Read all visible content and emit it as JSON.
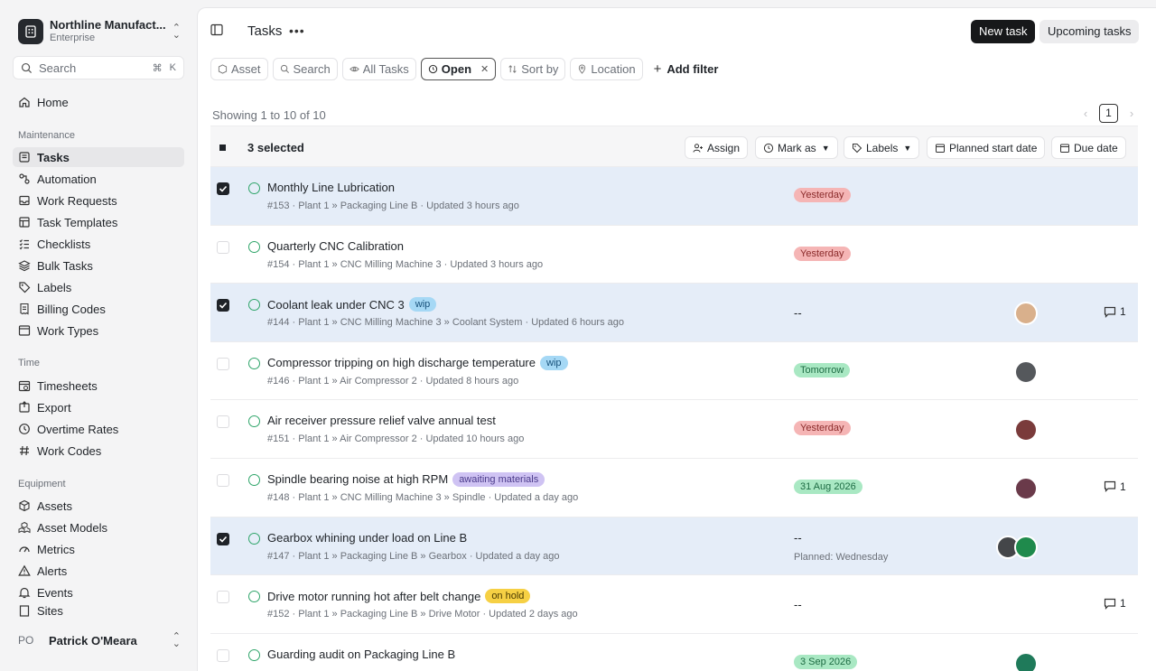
{
  "org": {
    "name": "Northline Manufact...",
    "plan": "Enterprise"
  },
  "search": {
    "label": "Search",
    "shortcut_mod": "⌘",
    "shortcut_key": "K"
  },
  "nav": {
    "home": "Home",
    "maintenance": {
      "heading": "Maintenance",
      "items": [
        "Tasks",
        "Automation",
        "Work Requests",
        "Task Templates",
        "Checklists",
        "Bulk Tasks",
        "Labels",
        "Billing Codes",
        "Work Types"
      ]
    },
    "time": {
      "heading": "Time",
      "items": [
        "Timesheets",
        "Export",
        "Overtime Rates",
        "Work Codes"
      ]
    },
    "equipment": {
      "heading": "Equipment",
      "items": [
        "Assets",
        "Asset Models",
        "Metrics",
        "Alerts",
        "Events",
        "Sites"
      ]
    }
  },
  "user": {
    "initials": "PO",
    "name": "Patrick O'Meara"
  },
  "header": {
    "title": "Tasks",
    "new_task": "New task",
    "upcoming": "Upcoming tasks"
  },
  "filters": {
    "asset": "Asset",
    "search": "Search",
    "all_tasks": "All Tasks",
    "open": "Open",
    "sort_by": "Sort by",
    "location": "Location",
    "add_filter": "Add filter"
  },
  "showing": "Showing 1 to 10 of 10",
  "pagination": {
    "current": "1"
  },
  "bulk": {
    "selected": "3 selected",
    "assign": "Assign",
    "mark_as": "Mark as",
    "labels": "Labels",
    "planned_start": "Planned start date",
    "due_date": "Due date"
  },
  "colors": {
    "selected_row": "#e5edf8",
    "status_open": "#2fa56a",
    "due_overdue": "#f5b5b5",
    "due_upcoming": "#a9e8c3"
  },
  "tasks": [
    {
      "title": "Monthly Line Lubrication",
      "badge": "",
      "meta": "#153 · Plant 1 » Packaging Line B · Updated 3 hours ago",
      "due": "Yesterday",
      "due_color": "red",
      "planned": "",
      "comments": "",
      "selected": true,
      "avatars": []
    },
    {
      "title": "Quarterly CNC Calibration",
      "badge": "",
      "meta": "#154 · Plant 1 » CNC Milling Machine 3 · Updated 3 hours ago",
      "due": "Yesterday",
      "due_color": "red",
      "planned": "",
      "comments": "",
      "selected": false,
      "avatars": []
    },
    {
      "title": "Coolant leak under CNC 3",
      "badge": "wip",
      "meta": "#144 · Plant 1 » CNC Milling Machine 3 » Coolant System · Updated 6 hours ago",
      "due": "--",
      "due_color": "",
      "planned": "",
      "comments": "1",
      "selected": true,
      "avatars": [
        "#d9b08c"
      ]
    },
    {
      "title": "Compressor tripping on high discharge temperature",
      "badge": "wip",
      "meta": "#146 · Plant 1 » Air Compressor 2 · Updated 8 hours ago",
      "due": "Tomorrow",
      "due_color": "green",
      "planned": "",
      "comments": "",
      "selected": false,
      "avatars": [
        "#55585c"
      ]
    },
    {
      "title": "Air receiver pressure relief valve annual test",
      "badge": "",
      "meta": "#151 · Plant 1 » Air Compressor 2 · Updated 10 hours ago",
      "due": "Yesterday",
      "due_color": "red",
      "planned": "",
      "comments": "",
      "selected": false,
      "avatars": [
        "#7a3b3b"
      ]
    },
    {
      "title": "Spindle bearing noise at high RPM",
      "badge": "awaiting materials",
      "meta": "#148 · Plant 1 » CNC Milling Machine 3 » Spindle · Updated a day ago",
      "due": "31 Aug 2026",
      "due_color": "green",
      "planned": "",
      "comments": "1",
      "selected": false,
      "avatars": [
        "#6a3a4a"
      ]
    },
    {
      "title": "Gearbox whining under load on Line B",
      "badge": "",
      "meta": "#147 · Plant 1 » Packaging Line B » Gearbox · Updated a day ago",
      "due": "--",
      "due_color": "",
      "planned": "Planned: Wednesday",
      "comments": "",
      "selected": true,
      "avatars": [
        "#444649",
        "#1f8a4c"
      ]
    },
    {
      "title": "Drive motor running hot after belt change",
      "badge": "on hold",
      "meta": "#152 · Plant 1 » Packaging Line B » Drive Motor · Updated 2 days ago",
      "due": "--",
      "due_color": "",
      "planned": "",
      "comments": "1",
      "selected": false,
      "avatars": []
    },
    {
      "title": "Guarding audit on Packaging Line B",
      "badge": "",
      "meta": "",
      "due": "3 Sep 2026",
      "due_color": "green",
      "planned": "",
      "comments": "",
      "selected": false,
      "avatars": [
        "#1f7a5a"
      ]
    }
  ]
}
